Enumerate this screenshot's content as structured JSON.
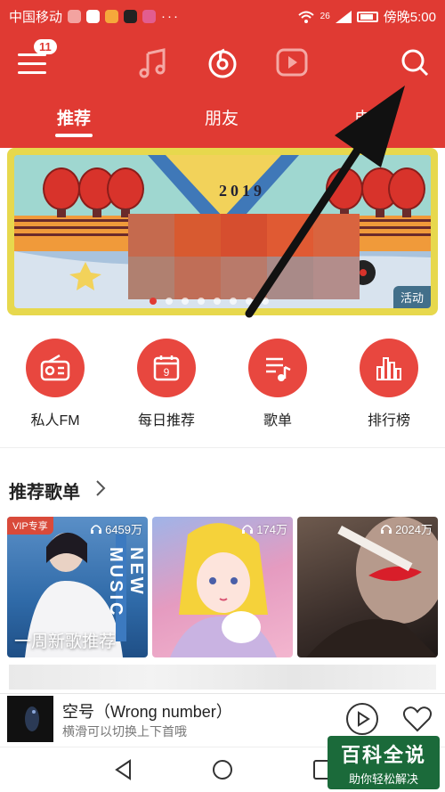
{
  "status_bar": {
    "carrier": "中国移动",
    "signal_text": "26",
    "time": "傍晚5:00"
  },
  "header": {
    "menu_badge": "11",
    "tabs": [
      "推荐",
      "朋友",
      "电"
    ]
  },
  "banner": {
    "year": "2019",
    "tag": "活动"
  },
  "quick_actions": [
    {
      "label": "私人FM",
      "icon": "radio-icon"
    },
    {
      "label": "每日推荐",
      "icon": "calendar-icon",
      "number": "9"
    },
    {
      "label": "歌单",
      "icon": "playlist-icon"
    },
    {
      "label": "排行榜",
      "icon": "chart-bars-icon"
    }
  ],
  "playlists_section": {
    "title": "推荐歌单",
    "items": [
      {
        "count": "6459万",
        "vip": "VIP专享",
        "caption": "一周新歌推荐",
        "side_text": "NEW MUSIC"
      },
      {
        "count": "174万"
      },
      {
        "count": "2024万"
      }
    ]
  },
  "player": {
    "title": "空号（Wrong number）",
    "subtitle": "横滑可以切换上下首哦"
  },
  "watermark": {
    "title": "百科全说",
    "subtitle": "助你轻松解决"
  },
  "colors": {
    "brand_red": "#e03a33"
  }
}
